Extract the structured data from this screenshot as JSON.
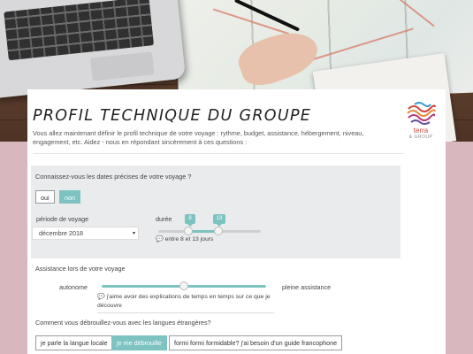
{
  "header": {
    "title": "PROFIL TECHNIQUE DU GROUPE",
    "intro": "Vous allez maintenant définir le profil technique de votre voyage : rythme, budget, assistance, hébergement, niveau, engagement, etc. Aidez - nous en répondant sincèrement à ces questions :",
    "logo_text": "terra",
    "logo_sub": "& GROUP"
  },
  "dates": {
    "question": "Connaissez-vous les dates précises de votre voyage ?",
    "yes": "oui",
    "no": "non",
    "selected": "non",
    "period_label": "période de voyage",
    "period_value": "décembre 2018",
    "duration_label": "durée",
    "duration_min": 8,
    "duration_max": 13,
    "duration_min_label": "8",
    "duration_max_label": "13",
    "duration_summary": "entre 8 et 13 jours"
  },
  "assistance": {
    "label": "Assistance lors de votre voyage",
    "left": "autonome",
    "right": "pleine assistance",
    "level": 0.5,
    "note": "j'aime avoir des explications de temps en temps sur ce que je découvre"
  },
  "languages": {
    "question": "Comment vous débrouillez-vous avec les langues étrangères?",
    "options": [
      "je parle la langue locale",
      "je me débrouille",
      "formi formi formidable? j'ai besoin d'un guide francophone"
    ],
    "selected": "je me débrouille"
  },
  "colors": {
    "accent": "#7cc3c1",
    "background": "#d9b7be"
  }
}
